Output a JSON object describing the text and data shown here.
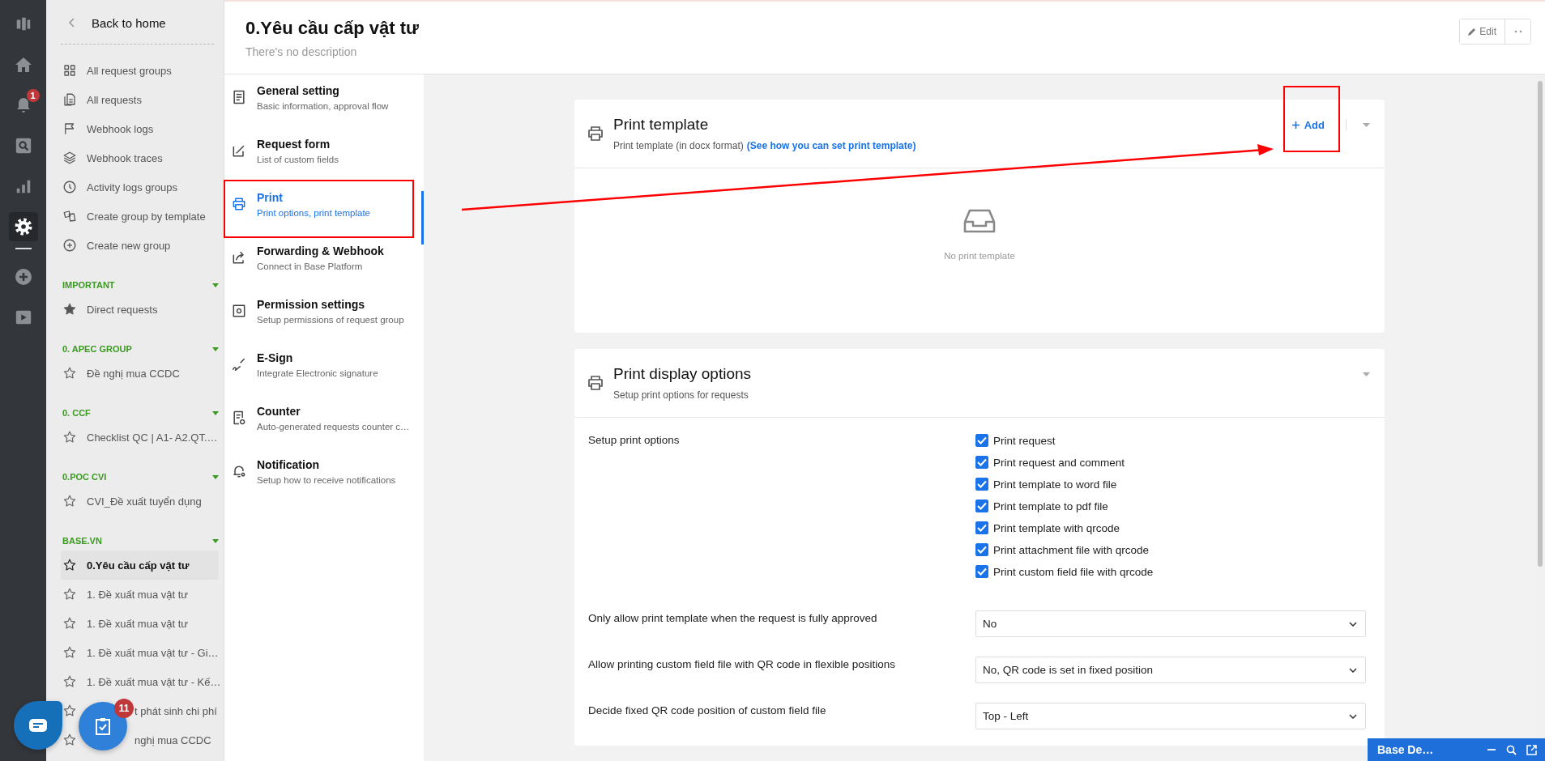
{
  "rail": {
    "items": [
      {
        "kind": "logo",
        "selected": false
      },
      {
        "kind": "home",
        "selected": false
      },
      {
        "kind": "bell",
        "selected": false,
        "badge": "1"
      },
      {
        "kind": "search",
        "selected": false
      },
      {
        "kind": "chart",
        "selected": false
      },
      {
        "kind": "gear",
        "selected": true
      },
      {
        "kind": "plus",
        "selected": false
      },
      {
        "kind": "play",
        "selected": false
      }
    ]
  },
  "sidebar": {
    "back_label": "Back to home",
    "menu": [
      {
        "kind": "grid",
        "label": "All request groups"
      },
      {
        "kind": "copy",
        "label": "All requests"
      },
      {
        "kind": "flag",
        "label": "Webhook logs"
      },
      {
        "kind": "layers",
        "label": "Webhook traces"
      },
      {
        "kind": "clock",
        "label": "Activity logs groups"
      },
      {
        "kind": "template",
        "label": "Create group by template"
      },
      {
        "kind": "plus",
        "label": "Create new group"
      }
    ],
    "groups": [
      {
        "title": "IMPORTANT",
        "items": [
          {
            "label": "Direct requests",
            "starred": true,
            "selected": false,
            "kind": "full"
          }
        ]
      },
      {
        "title": "0. APEC GROUP",
        "items": [
          {
            "label": "Đề nghị mua CCDC",
            "starred": false,
            "selected": false,
            "kind": "full"
          }
        ]
      },
      {
        "title": "0. CCF",
        "items": [
          {
            "label": "Checklist QC | A1- A2.QT.…",
            "starred": false,
            "selected": false,
            "kind": "full"
          }
        ]
      },
      {
        "title": "0.POC CVI",
        "items": [
          {
            "label": "CVI_Đề xuất tuyển dụng",
            "starred": false,
            "selected": false,
            "kind": "full"
          }
        ]
      },
      {
        "title": "BASE.VN",
        "items": [
          {
            "label": "0.Yêu cầu cấp vật tư",
            "starred": false,
            "selected": true,
            "kind": "full"
          },
          {
            "label": "1. Đề xuất mua vật tư",
            "starred": false,
            "selected": false,
            "kind": "full"
          },
          {
            "label": "1. Đề xuất mua vật tư",
            "starred": false,
            "selected": false,
            "kind": "full"
          },
          {
            "label": "1. Đề xuất mua vật tư - Gi…",
            "starred": false,
            "selected": false,
            "kind": "full"
          },
          {
            "label": "1. Đề xuất mua vật tư - Kế…",
            "starred": false,
            "selected": false,
            "kind": "full"
          },
          {
            "label": "t phát sinh chi phí",
            "starred": false,
            "selected": false,
            "kind": "partial"
          },
          {
            "label": "nghị mua CCDC",
            "starred": false,
            "selected": false,
            "kind": "partial"
          }
        ]
      }
    ]
  },
  "header": {
    "title": "0.Yêu cầu cấp vật tư",
    "description": "There's no description",
    "edit_label": "Edit"
  },
  "settings_nav": [
    {
      "kind": "general",
      "title": "General setting",
      "subtitle": "Basic information, approval flow",
      "selected": false
    },
    {
      "kind": "form",
      "title": "Request form",
      "subtitle": "List of custom fields",
      "selected": false
    },
    {
      "kind": "print",
      "title": "Print",
      "subtitle": "Print options, print template",
      "selected": true
    },
    {
      "kind": "forward",
      "title": "Forwarding & Webhook",
      "subtitle": "Connect in Base Platform",
      "selected": false
    },
    {
      "kind": "permission",
      "title": "Permission settings",
      "subtitle": "Setup permissions of request group",
      "selected": false
    },
    {
      "kind": "esign",
      "title": "E-Sign",
      "subtitle": "Integrate Electronic signature",
      "selected": false
    },
    {
      "kind": "counter",
      "title": "Counter",
      "subtitle": "Auto-generated requests counter c…",
      "selected": false
    },
    {
      "kind": "notify",
      "title": "Notification",
      "subtitle": "Setup how to receive notifications",
      "selected": false
    }
  ],
  "print_template": {
    "title": "Print template",
    "description": "Print template (in docx format)",
    "link": "(See how you can set print template)",
    "add_label": "Add",
    "empty_text": "No print template"
  },
  "print_display_options": {
    "title": "Print display options",
    "description": "Setup print options for requests",
    "options_label": "Setup print options",
    "options": [
      {
        "label": "Print request",
        "checked": true
      },
      {
        "label": "Print request and comment",
        "checked": true
      },
      {
        "label": "Print template to word file",
        "checked": true
      },
      {
        "label": "Print template to pdf file",
        "checked": true
      },
      {
        "label": "Print template with qrcode",
        "checked": true
      },
      {
        "label": "Print attachment file with qrcode",
        "checked": true
      },
      {
        "label": "Print custom field file with qrcode",
        "checked": true
      }
    ],
    "selects": [
      {
        "label": "Only allow print template when the request is fully approved",
        "value": "No"
      },
      {
        "label": "Allow printing custom field file with QR code in flexible positions",
        "value": "No, QR code is set in fixed position"
      },
      {
        "label": "Decide fixed QR code position of custom field file",
        "value": "Top - Left"
      }
    ]
  },
  "task_badge": "11",
  "chat_widget": {
    "title": "Base De…"
  }
}
